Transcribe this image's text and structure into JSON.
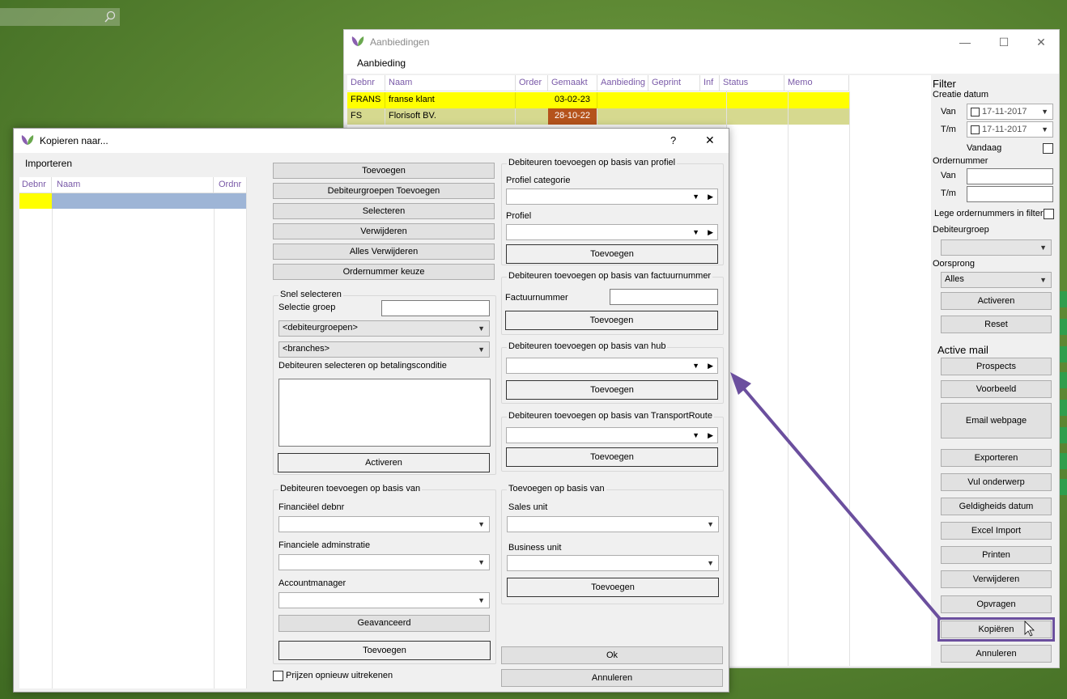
{
  "main_window": {
    "title": "Aanbiedingen",
    "menu": [
      "Aanbieding"
    ],
    "columns": [
      "Debnr",
      "Naam",
      "Order",
      "Gemaakt",
      "Aanbieding",
      "Geprint",
      "Inf",
      "Status",
      "Memo"
    ],
    "rows": [
      {
        "debnr": "FRANS",
        "naam": "franse klant",
        "gemaakt": "03-02-23"
      },
      {
        "debnr": "FS",
        "naam": "Florisoft BV.",
        "gemaakt": "28-10-22"
      }
    ],
    "colors": {
      "row_yellow": "#ffff00",
      "row_selected": "#d6d98f",
      "date_highlight": "#b5531b"
    }
  },
  "filter": {
    "title": "Filter",
    "creatie_datum": "Creatie datum",
    "van_label": "Van",
    "tm_label": "T/m",
    "van_date": "17-11-2017",
    "tm_date": "17-11-2017",
    "vandaag": "Vandaag",
    "ordernummer": "Ordernummer",
    "order_van": "Van",
    "order_tm": "T/m",
    "lege_ordernummers": "Lege ordernummers in filter",
    "debiteurgroep": "Debiteurgroep",
    "oorsprong": "Oorsprong",
    "oorsprong_value": "Alles",
    "activeren": "Activeren",
    "reset": "Reset",
    "active_mail": "Active mail",
    "buttons": [
      "Prospects",
      "Voorbeeld",
      "Email webpage",
      "Exporteren",
      "Vul onderwerp",
      "Geldigheids datum",
      "Excel Import",
      "Printen",
      "Verwijderen",
      "Opvragen",
      "Kopiëren",
      "Annuleren"
    ]
  },
  "dialog": {
    "title": "Kopieren naar...",
    "help": "?",
    "close": "✕",
    "importeren": "Importeren",
    "grid_columns": [
      "Debnr",
      "Naam",
      "Ordnr"
    ],
    "left_buttons": [
      "Toevoegen",
      "Debiteurgroepen Toevoegen",
      "Selecteren",
      "Verwijderen",
      "Alles Verwijderen",
      "Ordernummer keuze"
    ],
    "snel": {
      "title": "Snel selecteren",
      "selectie_groep": "Selectie groep",
      "debiteurgroepen": "<debiteurgroepen>",
      "branches": "<branches>",
      "betalingsconditie": "Debiteuren selecteren op betalingsconditie",
      "activeren": "Activeren"
    },
    "basis_van": {
      "title": "Debiteuren toevoegen op basis van",
      "financieel_debnr": "Financiëel debnr",
      "financiele_admin": "Financiele adminstratie",
      "accountmanager": "Accountmanager",
      "geavanceerd": "Geavanceerd",
      "toevoegen": "Toevoegen"
    },
    "prijzen": "Prijzen opnieuw uitrekenen",
    "profiel": {
      "title": "Debiteuren toevoegen op basis van profiel",
      "categorie": "Profiel categorie",
      "profiel": "Profiel",
      "toevoegen": "Toevoegen"
    },
    "factuur": {
      "title": "Debiteuren toevoegen op basis van factuurnummer",
      "label": "Factuurnummer",
      "toevoegen": "Toevoegen"
    },
    "hub": {
      "title": "Debiteuren toevoegen op basis van hub",
      "toevoegen": "Toevoegen"
    },
    "transport": {
      "title": "Debiteuren toevoegen op basis van TransportRoute",
      "toevoegen": "Toevoegen"
    },
    "toevoegen_basis": {
      "title": "Toevoegen op basis van",
      "sales_unit": "Sales unit",
      "business_unit": "Business unit",
      "toevoegen": "Toevoegen"
    },
    "ok": "Ok",
    "annuleren": "Annuleren"
  },
  "accent_color": "#6b4f9e"
}
